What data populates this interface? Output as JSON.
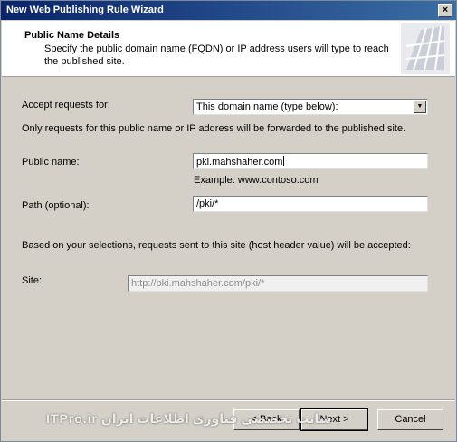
{
  "window": {
    "title": "New Web Publishing Rule Wizard",
    "close_glyph": "×"
  },
  "header": {
    "title": "Public Name Details",
    "description": "Specify the public domain name (FQDN) or IP address users will type to reach the published site."
  },
  "accept": {
    "label": "Accept requests for:",
    "selected": "This domain name (type below):",
    "note": "Only requests for this public name or IP address will be forwarded to the published site."
  },
  "public_name": {
    "label": "Public name:",
    "value": "pki.mahshaher.com",
    "example": "Example: www.contoso.com"
  },
  "path": {
    "label": "Path (optional):",
    "value": "/pki/*"
  },
  "summary": "Based on your selections, requests sent to this site (host header value) will be accepted:",
  "site": {
    "label": "Site:",
    "value": "http://pki.mahshaher.com/pki/*"
  },
  "buttons": {
    "back": "< Back",
    "next": "Next >",
    "cancel": "Cancel"
  },
  "watermark": "سایت تخصصی فناوری اطلاعات ایران ITPro.ir"
}
